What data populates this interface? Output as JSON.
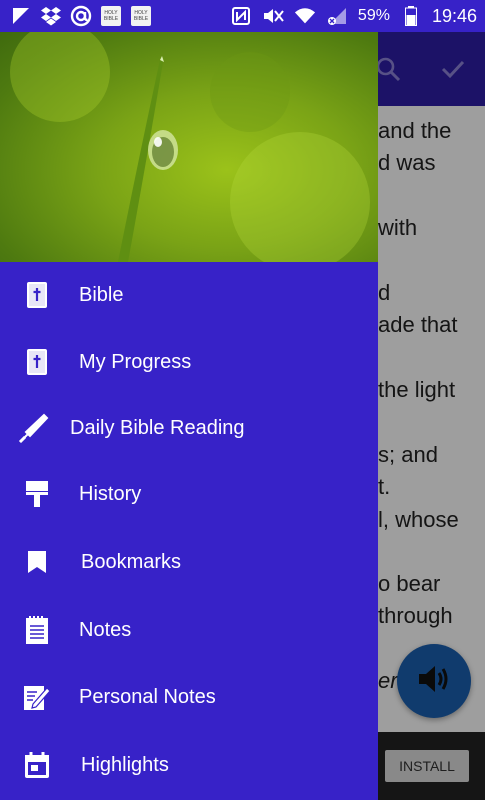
{
  "status_bar": {
    "battery": "59%",
    "time": "19:46",
    "left_icons": [
      "flipboard-icon",
      "dropbox-icon",
      "at-icon",
      "holy-bible-app-icon",
      "holy-bible-app-icon"
    ],
    "right_icons": [
      "nfc-icon",
      "mute-icon",
      "wifi-icon",
      "sim-off-icon",
      "signal-icon",
      "battery-icon"
    ]
  },
  "drawer": {
    "header_image": "water-droplet-on-grass",
    "items": [
      {
        "label": "Bible",
        "icon": "bible-icon"
      },
      {
        "label": "My Progress",
        "icon": "bible-progress-icon"
      },
      {
        "label": "Daily Bible Reading",
        "icon": "needle-icon"
      },
      {
        "label": "History",
        "icon": "paint-roller-icon"
      },
      {
        "label": "Bookmarks",
        "icon": "bookmark-icon"
      },
      {
        "label": "Notes",
        "icon": "notepad-icon"
      },
      {
        "label": "Personal Notes",
        "icon": "edit-note-icon"
      },
      {
        "label": "Highlights",
        "icon": "calendar-icon"
      }
    ]
  },
  "background": {
    "toolbar_icons": [
      "search-icon",
      "check-icon"
    ],
    "text_lines": [
      "and the",
      "d was",
      "with",
      "d",
      "ade that",
      "the light",
      "s; and",
      "t.",
      "l, whose",
      "o bear",
      "through",
      "er"
    ],
    "install_label": "INSTALL",
    "fab_icon": "speaker-icon"
  },
  "colors": {
    "primary": "#3722c8",
    "toolbar_dark": "#2e1ea6",
    "fab": "#1a5fb0"
  }
}
